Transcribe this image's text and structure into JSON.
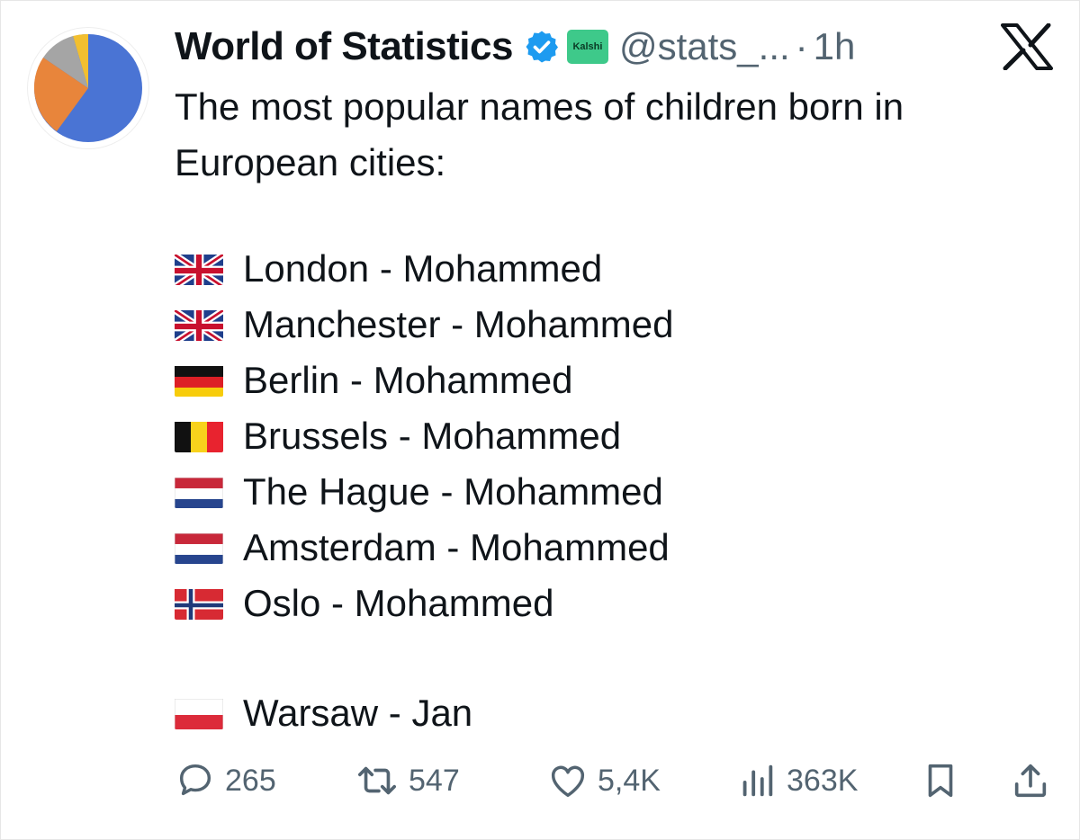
{
  "tweet": {
    "author": {
      "display_name": "World of Statistics",
      "handle": "@stats_...",
      "time": "1h",
      "separator": "·",
      "affiliate_badge": "Kalshi",
      "verified_icon": "verified-badge-icon",
      "avatar_icon": "pie-chart-avatar"
    },
    "text": "The most popular names of children born in European cities:",
    "entries": [
      {
        "flag": "uk-flag-icon",
        "text": "London - Mohammed"
      },
      {
        "flag": "uk-flag-icon",
        "text": "Manchester - Mohammed"
      },
      {
        "flag": "germany-flag-icon",
        "text": "Berlin - Mohammed"
      },
      {
        "flag": "belgium-flag-icon",
        "text": "Brussels - Mohammed"
      },
      {
        "flag": "netherlands-flag-icon",
        "text": "The Hague - Mohammed"
      },
      {
        "flag": "netherlands-flag-icon",
        "text": "Amsterdam - Mohammed"
      },
      {
        "flag": "norway-flag-icon",
        "text": "Oslo - Mohammed"
      },
      {
        "flag": "poland-flag-icon",
        "text": "Warsaw - Jan"
      }
    ]
  },
  "actions": {
    "replies": "265",
    "reposts": "547",
    "likes": "5,4K",
    "views": "363K"
  },
  "colors": {
    "text": "#0f1419",
    "secondary": "#536471",
    "verified": "#1d9bf0",
    "kalshi": "#3ec98a"
  }
}
